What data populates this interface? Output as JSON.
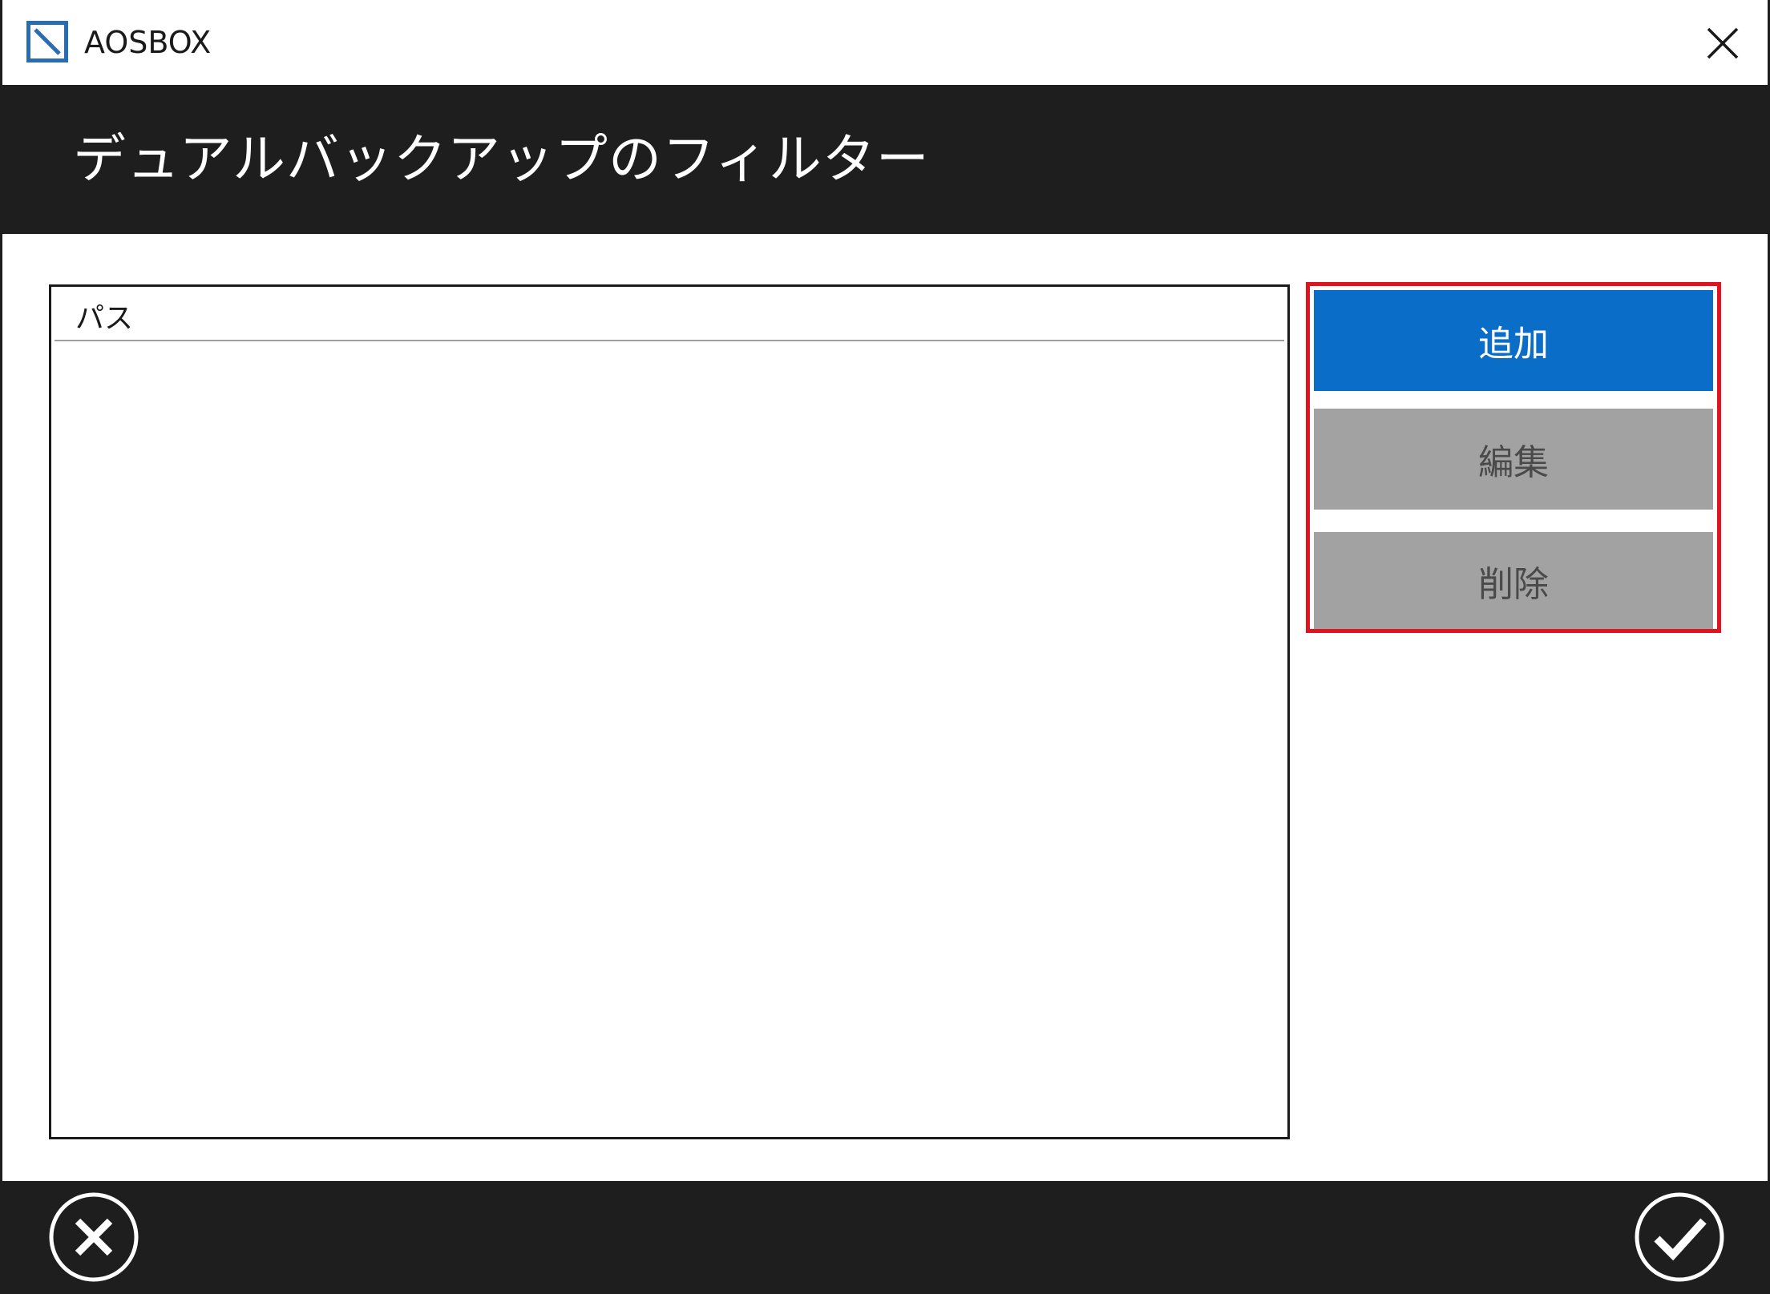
{
  "window": {
    "app_title": "AOSBOX",
    "app_icon": "aosbox-logo-icon",
    "close_icon": "close-icon"
  },
  "header": {
    "title": "デュアルバックアップのフィルター"
  },
  "list": {
    "columns": [
      "パス"
    ],
    "rows": []
  },
  "actions": {
    "add_label": "追加",
    "edit_label": "編集",
    "delete_label": "削除"
  },
  "footer": {
    "cancel_icon": "cancel-circle-icon",
    "ok_icon": "check-circle-icon"
  },
  "colors": {
    "accent": "#0a6dc8",
    "disabled_button": "#a2a2a2",
    "dark_band": "#1e1e1e",
    "highlight_border": "#e0141e"
  }
}
